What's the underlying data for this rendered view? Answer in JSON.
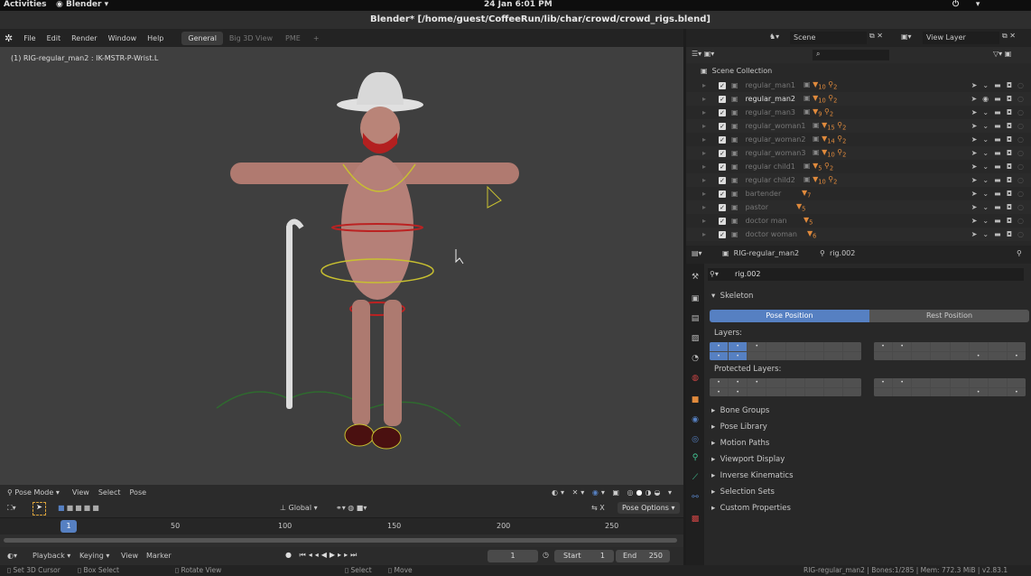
{
  "topbar": {
    "activities": "Activities",
    "app": "Blender ▾",
    "datetime": "24 Jan  6:01 PM"
  },
  "window_title": "Blender* [/home/guest/CoffeeRun/lib/char/crowd/crowd_rigs.blend]",
  "menu": [
    "File",
    "Edit",
    "Render",
    "Window",
    "Help"
  ],
  "workspaces": [
    {
      "label": "General",
      "active": true
    },
    {
      "label": "Big 3D View"
    },
    {
      "label": "PME"
    },
    {
      "label": "+"
    }
  ],
  "viewport": {
    "info": "(1) RIG-regular_man2 : IK-MSTR-P-Wrist.L",
    "mode": "Pose Mode",
    "menus": [
      "View",
      "Select",
      "Pose"
    ],
    "orientation": "Global",
    "pose_options": "Pose Options",
    "x_label": "X"
  },
  "timeline": {
    "ticks": [
      "50",
      "100",
      "150",
      "200",
      "250"
    ],
    "current_frame": "1",
    "menus": [
      "Playback",
      "Keying",
      "View",
      "Marker"
    ],
    "frame_field": "1",
    "start_label": "Start",
    "start": "1",
    "end_label": "End",
    "end": "250"
  },
  "status": {
    "items": [
      "Set 3D Cursor",
      "Box Select",
      "Rotate View",
      "Select",
      "Move"
    ],
    "info": "RIG-regular_man2 | Bones:1/285 | Mem: 772.3 MiB | v2.83.1"
  },
  "scene": {
    "scene": "Scene",
    "view_layer": "View Layer"
  },
  "outliner": {
    "root": "Scene Collection",
    "rows": [
      {
        "name": "regular_man1",
        "b1": "10",
        "b2": "2"
      },
      {
        "name": "regular_man2",
        "b1": "10",
        "b2": "2",
        "selected": true
      },
      {
        "name": "regular_man3",
        "b1": "9",
        "b2": "2"
      },
      {
        "name": "regular_woman1",
        "b1": "15",
        "b2": "2"
      },
      {
        "name": "regular_woman2",
        "b1": "14",
        "b2": "2"
      },
      {
        "name": "regular_woman3",
        "b1": "10",
        "b2": "2"
      },
      {
        "name": "regular child1",
        "b1": "5",
        "b2": "2"
      },
      {
        "name": "regular child2",
        "b1": "10",
        "b2": "2"
      },
      {
        "name": "bartender",
        "b1": "7"
      },
      {
        "name": "pastor",
        "b1": "5"
      },
      {
        "name": "doctor man",
        "b1": "5"
      },
      {
        "name": "doctor woman",
        "b1": "6"
      }
    ]
  },
  "properties": {
    "object": "RIG-regular_man2",
    "armature": "rig.002",
    "data_field": "rig.002",
    "skeleton": "Skeleton",
    "pose_position": "Pose Position",
    "rest_position": "Rest Position",
    "layers": "Layers:",
    "protected_layers": "Protected Layers:",
    "panels": [
      "Bone Groups",
      "Pose Library",
      "Motion Paths",
      "Viewport Display",
      "Inverse Kinematics",
      "Selection Sets",
      "Custom Properties"
    ]
  },
  "colors": {
    "accent": "#5680c2",
    "badge": "#e08a3c"
  }
}
